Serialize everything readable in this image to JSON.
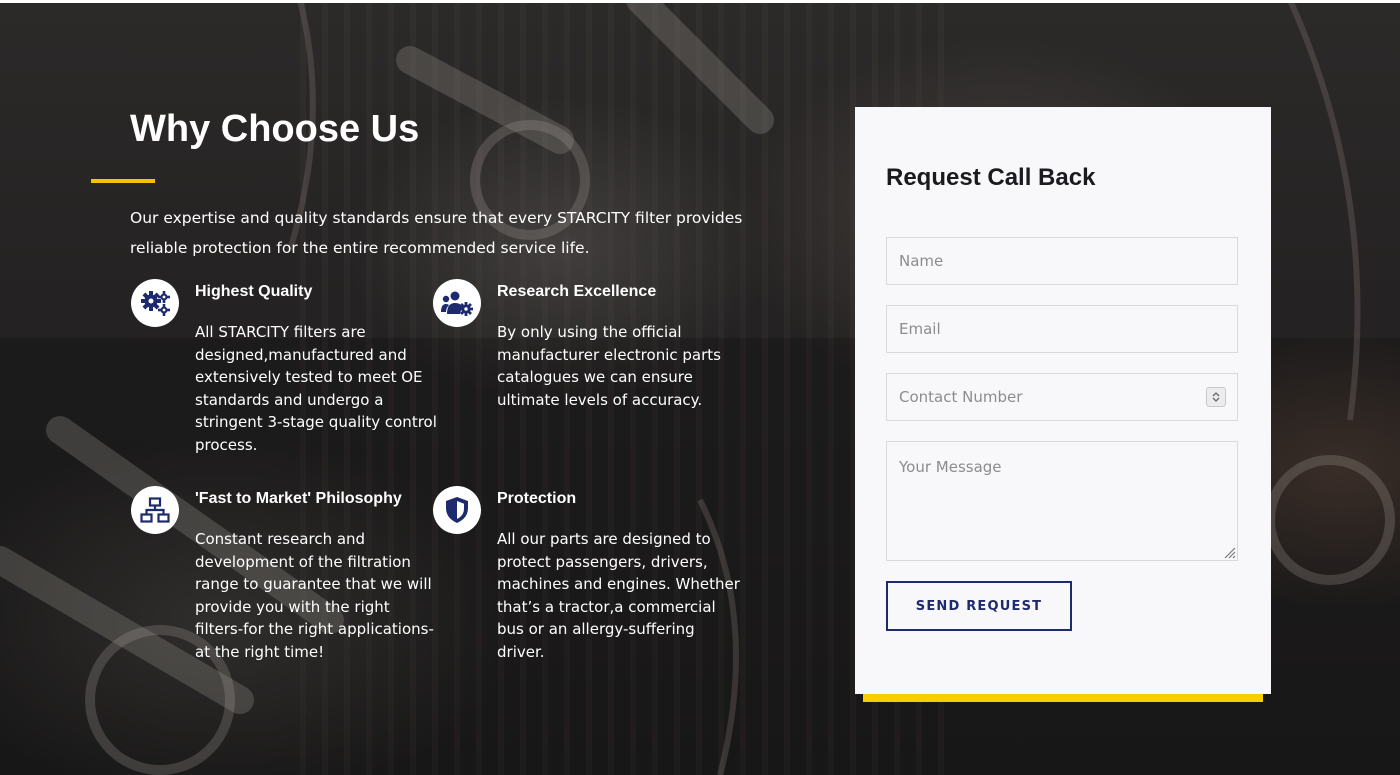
{
  "section": {
    "title": "Why Choose Us",
    "intro": "Our expertise and quality standards ensure that every STARCITY filter provides reliable protection for the entire recommended service life."
  },
  "features": [
    {
      "icon": "gears-icon",
      "title": "Highest Quality",
      "text": "All STARCITY filters are designed,manufactured and extensively tested to meet OE standards and undergo a stringent 3-stage quality control process."
    },
    {
      "icon": "team-gear-icon",
      "title": "Research Excellence",
      "text": "By only using the official manufacturer electronic parts catalogues we can ensure ultimate levels of accuracy."
    },
    {
      "icon": "network-icon",
      "title": "'Fast to Market' Philosophy",
      "text": "Constant research and development of the filtration range to guarantee that we will provide you with the right filters-for the right applications-at the right time!"
    },
    {
      "icon": "shield-icon",
      "title": "Protection",
      "text": "All our parts are designed to protect passengers, drivers, machines and engines. Whether that’s a tractor,a commercial bus or an allergy-suffering driver."
    }
  ],
  "form": {
    "title": "Request Call Back",
    "name_placeholder": "Name",
    "email_placeholder": "Email",
    "contact_placeholder": "Contact Number",
    "message_placeholder": "Your Message",
    "submit_label": "SEND REQUEST"
  },
  "colors": {
    "accent_yellow": "#f2c400",
    "brand_navy": "#1d2a6d",
    "card_background": "#f8f8fa"
  }
}
